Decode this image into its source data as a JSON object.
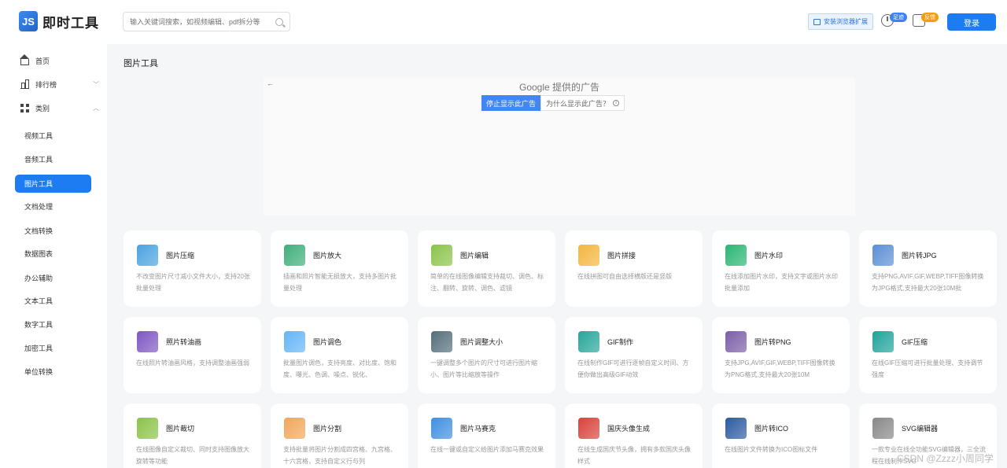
{
  "app": {
    "logo_mark": "JS",
    "name": "即时工具"
  },
  "search": {
    "placeholder": "输入关键词搜索，如视频编辑、pdf拆分等"
  },
  "header": {
    "extension_button": "安装浏览器扩展",
    "history_badge": "足迹",
    "feedback_badge": "反馈",
    "login_button": "登录"
  },
  "sidebar": {
    "home": "首页",
    "ranking": "排行榜",
    "category": "类别",
    "items": [
      "视频工具",
      "音频工具",
      "图片工具",
      "文档处理",
      "文档转换",
      "数据图表",
      "办公辅助",
      "文本工具",
      "数字工具",
      "加密工具",
      "单位转换"
    ],
    "active_index": 2
  },
  "page": {
    "title": "图片工具"
  },
  "ad": {
    "back": "←",
    "provider": "Google 提供的广告",
    "stop_button": "停止显示此广告",
    "why_button": "为什么显示此广告？",
    "info_glyph": "i"
  },
  "cards": [
    {
      "title": "图片压缩",
      "desc": "不改变图片尺寸减小文件大小，支持20张批量处理",
      "icon": "image-compress-icon",
      "color": "#4aa3df"
    },
    {
      "title": "图片放大",
      "desc": "插画和照片智能无损放大，支持多图片批量处理",
      "icon": "image-enlarge-icon",
      "color": "#3fae7a"
    },
    {
      "title": "图片编辑",
      "desc": "简单的在线图像编辑支持裁切、调色、标注、翻转、旋转、调色、滤镜",
      "icon": "image-edit-icon",
      "color": "#8bc34a"
    },
    {
      "title": "图片拼接",
      "desc": "在线拼图可自由选择横版还是竖版",
      "icon": "puzzle-icon",
      "color": "#f4b63f"
    },
    {
      "title": "图片水印",
      "desc": "在线添加图片水印，支持文字或图片水印批量添加",
      "icon": "watermark-icon",
      "color": "#2bb673"
    },
    {
      "title": "图片转JPG",
      "desc": "支持PNG,AVIF,GIF,WEBP,TIFF图像转换为JPG格式,支持最大20张10M批",
      "icon": "jpg-file-icon",
      "color": "#5b8fd6"
    },
    {
      "title": "照片转油画",
      "desc": "在线照片转油画风格，支持调整油画强弱",
      "icon": "paint-tube-icon",
      "color": "#7e57c2"
    },
    {
      "title": "图片调色",
      "desc": "批量图片调色，支持亮度、对比度、饱和度、曝光、色调、噪点、锐化、",
      "icon": "color-adjust-icon",
      "color": "#64b5f6"
    },
    {
      "title": "图片调整大小",
      "desc": "一键调整多个图片的尺寸可进行图片缩小、图片等比缩放等操作",
      "icon": "resize-magnifier-icon",
      "color": "#546e7a"
    },
    {
      "title": "GIF制作",
      "desc": "在线制作GIF可进行逐帧自定义时间、方便你做出高级GIF动效",
      "icon": "gif-make-icon",
      "color": "#26a69a"
    },
    {
      "title": "图片转PNG",
      "desc": "支持JPG,AVIF,GIF,WEBP,TIFF图像转换为PNG格式,支持最大20张10M",
      "icon": "png-file-icon",
      "color": "#7b5ea7"
    },
    {
      "title": "GIF压缩",
      "desc": "在线GIF压缩可进行批量处理、支持调节强度",
      "icon": "gif-compress-icon",
      "color": "#1fa39a"
    },
    {
      "title": "图片裁切",
      "desc": "在线图像自定义裁切、同时支持图像放大旋转等功能",
      "icon": "crop-icon",
      "color": "#8bc34a"
    },
    {
      "title": "图片分割",
      "desc": "支持批量将图片分割成四宫格、九宫格、十六宫格，支持自定义行与列",
      "icon": "image-split-icon",
      "color": "#f2a65a"
    },
    {
      "title": "图片马赛克",
      "desc": "在线一键或自定义给图片添加马赛克效果",
      "icon": "mosaic-icon",
      "color": "#3f8fe0"
    },
    {
      "title": "国庆头像生成",
      "desc": "在线生成国庆节头像，拥有多款国庆头像样式",
      "icon": "national-day-avatar-icon",
      "color": "#d9423a"
    },
    {
      "title": "图片转ICO",
      "desc": "在线图片文件转换为ICO图标文件",
      "icon": "ico-file-icon",
      "color": "#2c5aa0"
    },
    {
      "title": "SVG编辑器",
      "desc": "一款专业在线全功能SVG编辑器，三全流程在线制作SVG",
      "icon": "svg-editor-icon",
      "color": "#888888"
    }
  ],
  "watermark": "CSDN @Zzzz小周同学"
}
